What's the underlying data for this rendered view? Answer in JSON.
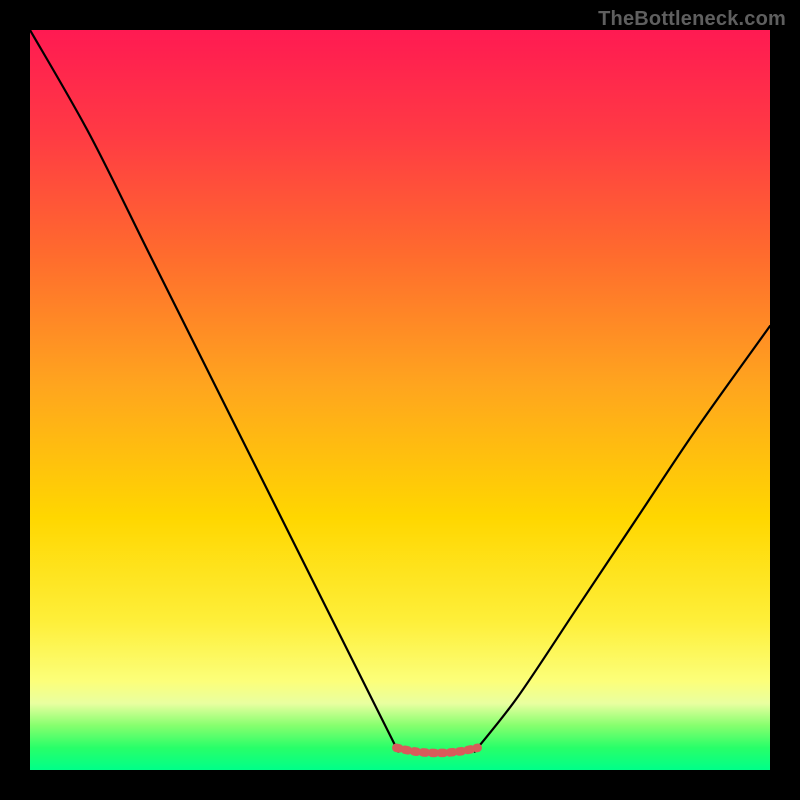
{
  "watermark": "TheBottleneck.com",
  "colors": {
    "background_border": "#000000",
    "curve": "#000000",
    "dot_band": "#d75b5b",
    "watermark": "#5f5f5f",
    "gradient_top": "#ff1a52",
    "gradient_mid": "#ffd700",
    "gradient_bottom": "#00ff89"
  },
  "chart_data": {
    "type": "line",
    "title": "",
    "xlabel": "",
    "ylabel": "",
    "xlim": [
      0,
      100
    ],
    "ylim": [
      0,
      100
    ],
    "grid": false,
    "legend": false,
    "series": [
      {
        "name": "left-curve",
        "x": [
          0,
          8,
          16,
          24,
          32,
          40,
          46,
          49.5
        ],
        "y": [
          100,
          86,
          70,
          54,
          38,
          22,
          10,
          3
        ]
      },
      {
        "name": "valley-band",
        "x": [
          49.5,
          52,
          55,
          58,
          60.5
        ],
        "y": [
          3,
          2.5,
          2.3,
          2.5,
          3
        ]
      },
      {
        "name": "right-curve",
        "x": [
          60.5,
          66,
          74,
          82,
          90,
          100
        ],
        "y": [
          3,
          10,
          22,
          34,
          46,
          60
        ]
      }
    ],
    "annotations": []
  }
}
